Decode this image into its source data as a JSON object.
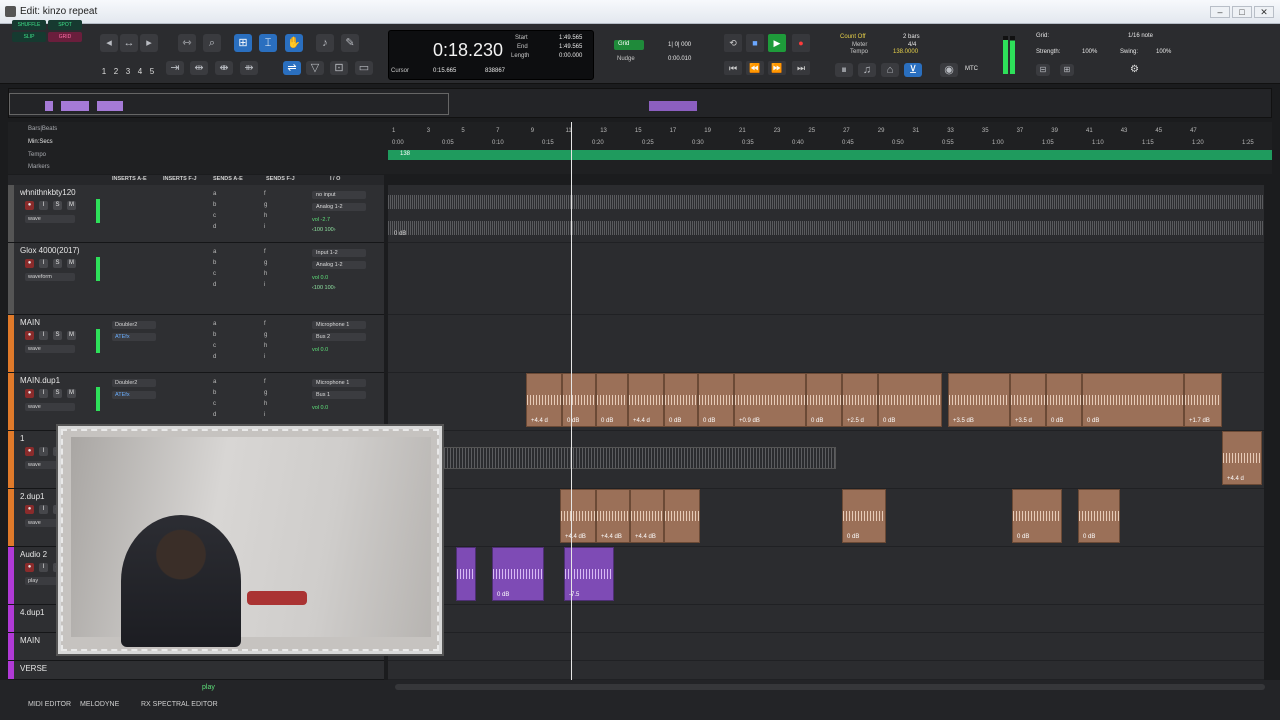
{
  "window": {
    "title": "Edit: kinzo repeat",
    "min": "–",
    "max": "□",
    "close": "✕"
  },
  "modes": {
    "shuffle": "SHUFFLE",
    "spot": "SPOT",
    "slip": "SLIP",
    "grid": "GRID"
  },
  "zoom_presets": [
    "1",
    "2",
    "3",
    "4",
    "5"
  ],
  "counter": {
    "main": "0:18.230",
    "start_label": "Start",
    "start": "1:49.565",
    "end_label": "End",
    "end": "1:49.565",
    "length_label": "Length",
    "length": "0:00.000",
    "cursor_label": "Cursor",
    "cursor": "0:15.665",
    "samples": "838867"
  },
  "grid_nudge": {
    "grid_label": "Grid",
    "grid_value": "1| 0| 000",
    "nudge_label": "Nudge",
    "nudge_value": "0:00.010"
  },
  "meter": {
    "count_off": "Count Off",
    "count_off_value": "2 bars",
    "meter_label": "Meter",
    "meter_value": "4/4",
    "tempo_label": "Tempo",
    "tempo_value": "138.0000"
  },
  "grid_panel": {
    "grid_label": "Grid:",
    "grid_value": "1/16 note",
    "strength_label": "Strength:",
    "strength_value": "100%",
    "swing_label": "Swing:",
    "swing_value": "100%"
  },
  "rulers": {
    "bars_beats": "Bars|Beats",
    "min_secs": "Min:Secs",
    "tempo": "Tempo",
    "markers": "Markers"
  },
  "bar_ticks": [
    "1",
    "3",
    "5",
    "7",
    "9",
    "11",
    "13",
    "15",
    "17",
    "19",
    "21",
    "23",
    "25",
    "27",
    "29",
    "31",
    "33",
    "35",
    "37",
    "39",
    "41",
    "43",
    "45",
    "47"
  ],
  "time_ticks": [
    "0:00",
    "0:05",
    "0:10",
    "0:15",
    "0:20",
    "0:25",
    "0:30",
    "0:35",
    "0:40",
    "0:45",
    "0:50",
    "0:55",
    "1:00",
    "1:05",
    "1:10",
    "1:15",
    "1:20",
    "1:25"
  ],
  "tempo_marker": "138",
  "columns": {
    "inserts_ae": "INSERTS A-E",
    "inserts_fj": "INSERTS F-J",
    "sends_ae": "SENDS A-E",
    "sends_fj": "SENDS F-J",
    "io": "I / O"
  },
  "tracks": [
    {
      "name": "whnithnkbty120",
      "io_in": "no input",
      "io_out": "Analog 1-2",
      "vol": "vol  -2.7",
      "pan": "‹100  100›",
      "insert": "",
      "insert2": "",
      "view": "wave"
    },
    {
      "name": "Glox 4000(2017)",
      "io_in": "Input 1-2",
      "io_out": "Analog 1-2",
      "vol": "vol  0.0",
      "pan": "‹100  100›",
      "insert": "",
      "insert2": "",
      "view": "waveform"
    },
    {
      "name": "MAIN",
      "io_in": "Microphone 1",
      "io_out": "Bus 2",
      "vol": "vol  0.0",
      "pan": "",
      "insert": "Doubler2",
      "insert2": "ATEfx",
      "view": "wave"
    },
    {
      "name": "MAIN.dup1",
      "io_in": "Microphone 1",
      "io_out": "Bus 1",
      "vol": "vol  0.0",
      "pan": "",
      "insert": "Doubler2",
      "insert2": "ATEfx",
      "view": "wave"
    },
    {
      "name": "1",
      "io_in": "",
      "io_out": "",
      "vol": "",
      "pan": "",
      "insert": "",
      "insert2": "",
      "view": "wave"
    },
    {
      "name": "2.dup1",
      "io_in": "",
      "io_out": "",
      "vol": "",
      "pan": "",
      "insert": "",
      "insert2": "",
      "view": "wave"
    },
    {
      "name": "Audio 2",
      "io_in": "",
      "io_out": "",
      "vol": "",
      "pan": "",
      "insert": "",
      "insert2": "",
      "view": "play"
    },
    {
      "name": "4.dup1",
      "io_in": "",
      "io_out": "",
      "vol": "",
      "pan": "",
      "insert": "",
      "insert2": "",
      "view": ""
    },
    {
      "name": "MAIN",
      "io_in": "",
      "io_out": "",
      "vol": "",
      "pan": "",
      "insert": "",
      "insert2": "",
      "view": ""
    },
    {
      "name": "VERSE",
      "io_in": "",
      "io_out": "",
      "vol": "",
      "pan": "",
      "insert": "",
      "insert2": "",
      "view": ""
    }
  ],
  "gain_top": "0 dB",
  "clips_main_dup": [
    "+4.4 d",
    "0 dB",
    "0 dB",
    "+4.4 d",
    "0 dB",
    "0 dB",
    "+0.9 dB",
    "0 dB",
    "+2.5 d",
    "0 dB",
    "+3.5 dB",
    "+3.5 d",
    "0 dB",
    "0 dB",
    "+1.7 dB"
  ],
  "clips_main_dup_right": "+4.4 d",
  "clips_2dup": [
    "+4.4 dB",
    "+4.4 dB",
    "+4.4 dB",
    "0 dB",
    "0 dB",
    "0 dB"
  ],
  "clips_audio2": [
    "0 dB",
    "-7.5"
  ],
  "status_play": "play",
  "bottom_tabs": [
    "MIDI EDITOR",
    "MELODYNE",
    "RX SPECTRAL EDITOR"
  ]
}
